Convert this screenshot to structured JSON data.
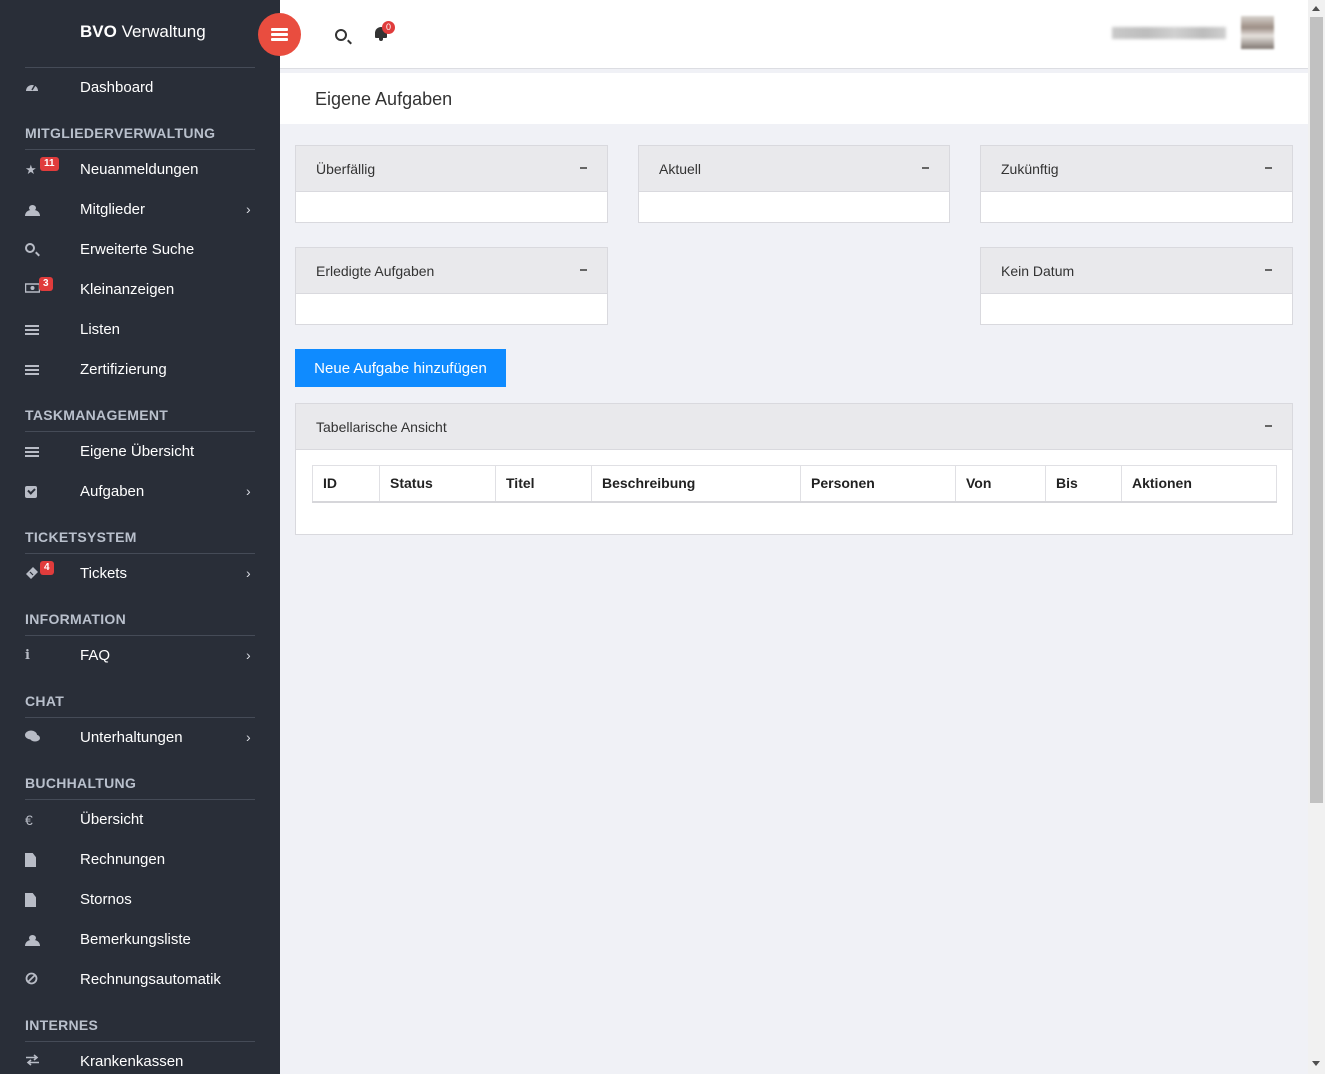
{
  "app": {
    "brand_bold": "BVO",
    "brand_light": "Verwaltung"
  },
  "topbar": {
    "notification_count": "0"
  },
  "sidebar": {
    "dashboard": "Dashboard",
    "sections": {
      "mitglieder": "MITGLIEDERVERWALTUNG",
      "task": "TASKMANAGEMENT",
      "ticket": "TICKETSYSTEM",
      "info": "INFORMATION",
      "chat": "CHAT",
      "buchhaltung": "BUCHHALTUNG",
      "internes": "INTERNES"
    },
    "items": {
      "neuanmeldungen": {
        "label": "Neuanmeldungen",
        "badge": "11"
      },
      "mitglieder": {
        "label": "Mitglieder"
      },
      "erweiterte_suche": {
        "label": "Erweiterte Suche"
      },
      "kleinanzeigen": {
        "label": "Kleinanzeigen",
        "badge": "3"
      },
      "listen": {
        "label": "Listen"
      },
      "zertifizierung": {
        "label": "Zertifizierung"
      },
      "eigene_uebersicht": {
        "label": "Eigene Übersicht"
      },
      "aufgaben": {
        "label": "Aufgaben"
      },
      "tickets": {
        "label": "Tickets",
        "badge": "4"
      },
      "faq": {
        "label": "FAQ"
      },
      "unterhaltungen": {
        "label": "Unterhaltungen"
      },
      "uebersicht": {
        "label": "Übersicht"
      },
      "rechnungen": {
        "label": "Rechnungen"
      },
      "stornos": {
        "label": "Stornos"
      },
      "bemerkungsliste": {
        "label": "Bemerkungsliste"
      },
      "rechnungsautomatik": {
        "label": "Rechnungsautomatik"
      },
      "krankenkassen": {
        "label": "Krankenkassen"
      }
    },
    "icons": {
      "euro": "€",
      "info": "i",
      "chevron": "›"
    }
  },
  "main": {
    "page_title": "Eigene Aufgaben",
    "panels": {
      "ueberfaellig": "Überfällig",
      "aktuell": "Aktuell",
      "zukuenftig": "Zukünftig",
      "erledigt": "Erledigte Aufgaben",
      "kein_datum": "Kein Datum"
    },
    "add_button": "Neue Aufgabe hinzufügen",
    "table_panel_title": "Tabellarische Ansicht",
    "table_headers": [
      "ID",
      "Status",
      "Titel",
      "Beschreibung",
      "Personen",
      "Von",
      "Bis",
      "Aktionen"
    ]
  },
  "colors": {
    "sidebar_bg": "#292e38",
    "accent_red": "#e94d3f",
    "primary_button": "#0f8bff",
    "badge_red": "#e03c3c"
  }
}
